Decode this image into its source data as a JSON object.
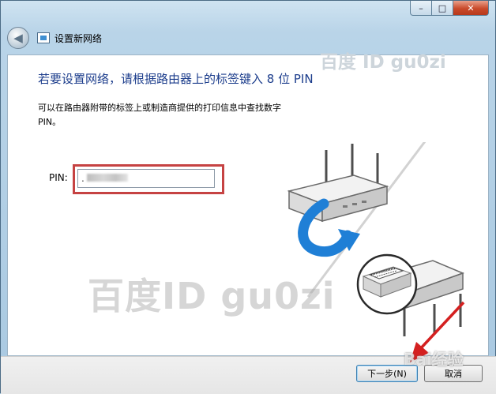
{
  "window": {
    "title": "设置新网络",
    "caption": {
      "minimize": "–",
      "maximize": "□",
      "close": "✕"
    }
  },
  "main": {
    "heading": "若要设置网络，请根据路由器上的标签键入 8 位 PIN",
    "description": "可以在路由器附带的标签上或制造商提供的打印信息中查找数字 PIN。",
    "pin_label": "PIN:",
    "pin_value": "."
  },
  "footer": {
    "next_label": "下一步(N)",
    "cancel_label": "取消"
  },
  "watermarks": {
    "top": "百度 ID gu0zi",
    "center": "百度ID gu0zi",
    "baidu": "Bai经验"
  },
  "colors": {
    "heading": "#1c3d8c",
    "highlight": "#c64343",
    "arrow": "#1f7fd6"
  },
  "icons": {
    "back": "back-arrow-icon",
    "network": "network-setup-icon",
    "router": "router-icon",
    "sync_arrow": "blue-curved-arrow-icon"
  }
}
